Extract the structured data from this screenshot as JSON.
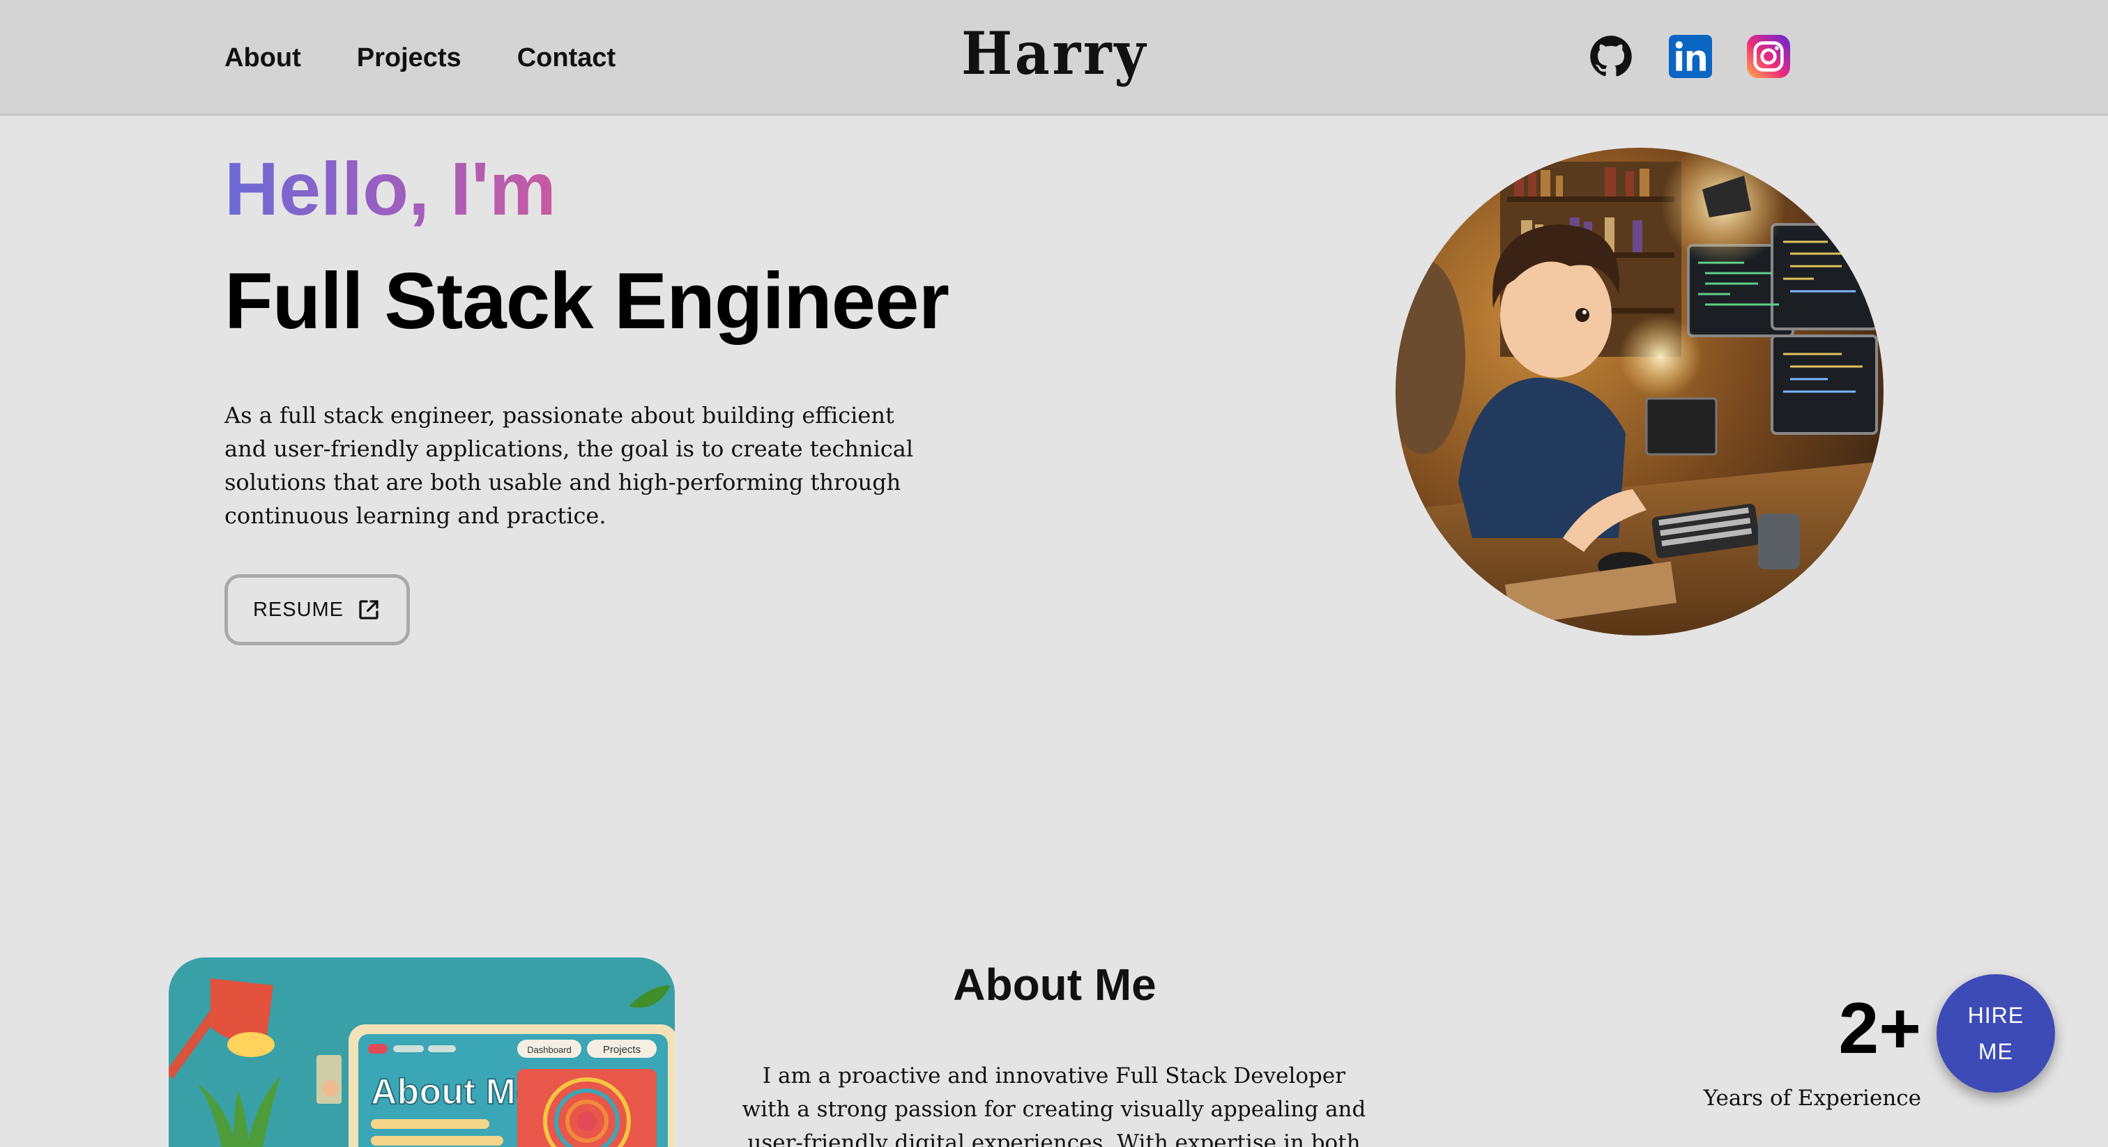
{
  "nav": {
    "links": [
      "About",
      "Projects",
      "Contact"
    ],
    "logo": "Harry",
    "social_icons": [
      "github-icon",
      "linkedin-icon",
      "instagram-icon"
    ]
  },
  "hero": {
    "greeting": "Hello, I'm",
    "title": "Full Stack Engineer",
    "description": "As a full stack engineer, passionate about building efficient and user-friendly applications, the goal is to create technical solutions that are both usable and high-performing through continuous learning and practice.",
    "resume_label": "RESUME",
    "resume_icon": "external-link-icon",
    "greeting_gradient": [
      "#6a6ad6",
      "#c85aa2"
    ]
  },
  "about": {
    "heading": "About Me",
    "image_text": "About Me",
    "image_tab_1": "Dashboard",
    "image_tab_2": "Projects",
    "text": "I am a proactive and innovative Full Stack Developer with a strong passion for creating visually appealing and user-friendly digital experiences. With expertise in both front-end",
    "stat_value": "2+",
    "stat_label": "Years of Experience"
  },
  "hire": {
    "label": "HIRE ME",
    "color": "#3d4bb7"
  }
}
